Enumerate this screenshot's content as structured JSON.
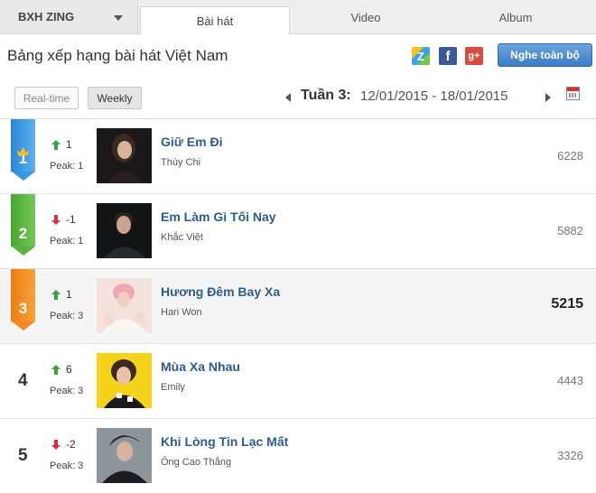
{
  "section_dropdown": {
    "label": "BXH ZING"
  },
  "tabs": [
    {
      "label": "Bài hát",
      "active": true
    },
    {
      "label": "Video",
      "active": false
    },
    {
      "label": "Album",
      "active": false
    }
  ],
  "header": {
    "title": "Bảng xếp hạng bài hát Việt Nam",
    "share_icons": [
      "zing-icon",
      "facebook-icon",
      "google-plus-icon"
    ],
    "share_glyphs": {
      "zing": "Z",
      "facebook": "f",
      "google_plus": "g+"
    },
    "play_all_label": "Nghe toàn bộ"
  },
  "filters": {
    "realtime_label": "Real-time",
    "weekly_label": "Weekly"
  },
  "week": {
    "label": "Tuần 3:",
    "range": "12/01/2015 - 18/01/2015"
  },
  "colors": {
    "rank1": "#3a96de",
    "rank2": "#5ab540",
    "rank3": "#f28a22",
    "up": "#3aa33a",
    "down": "#d9303a",
    "title": "#2c5c8e",
    "accent_button": "#4a8bd2"
  },
  "songs": [
    {
      "rank": "1",
      "direction": "up",
      "change": "1",
      "peak": "Peak: 1",
      "title": "Giữ Em Đi",
      "artist": "Thùy Chi",
      "views": "6228"
    },
    {
      "rank": "2",
      "direction": "down",
      "change": "-1",
      "peak": "Peak: 1",
      "title": "Em Làm Gì Tối Nay",
      "artist": "Khắc Việt",
      "views": "5882"
    },
    {
      "rank": "3",
      "direction": "up",
      "change": "1",
      "peak": "Peak: 3",
      "title": "Hương Đêm Bay Xa",
      "artist": "Hari Won",
      "views": "5215"
    },
    {
      "rank": "4",
      "direction": "up",
      "change": "6",
      "peak": "Peak: 3",
      "title": "Mùa Xa Nhau",
      "artist": "Emily",
      "views": "4443"
    },
    {
      "rank": "5",
      "direction": "down",
      "change": "-2",
      "peak": "Peak: 3",
      "title": "Khi Lòng Tin Lạc Mất",
      "artist": "Ông Cao Thắng",
      "views": "3326"
    }
  ]
}
